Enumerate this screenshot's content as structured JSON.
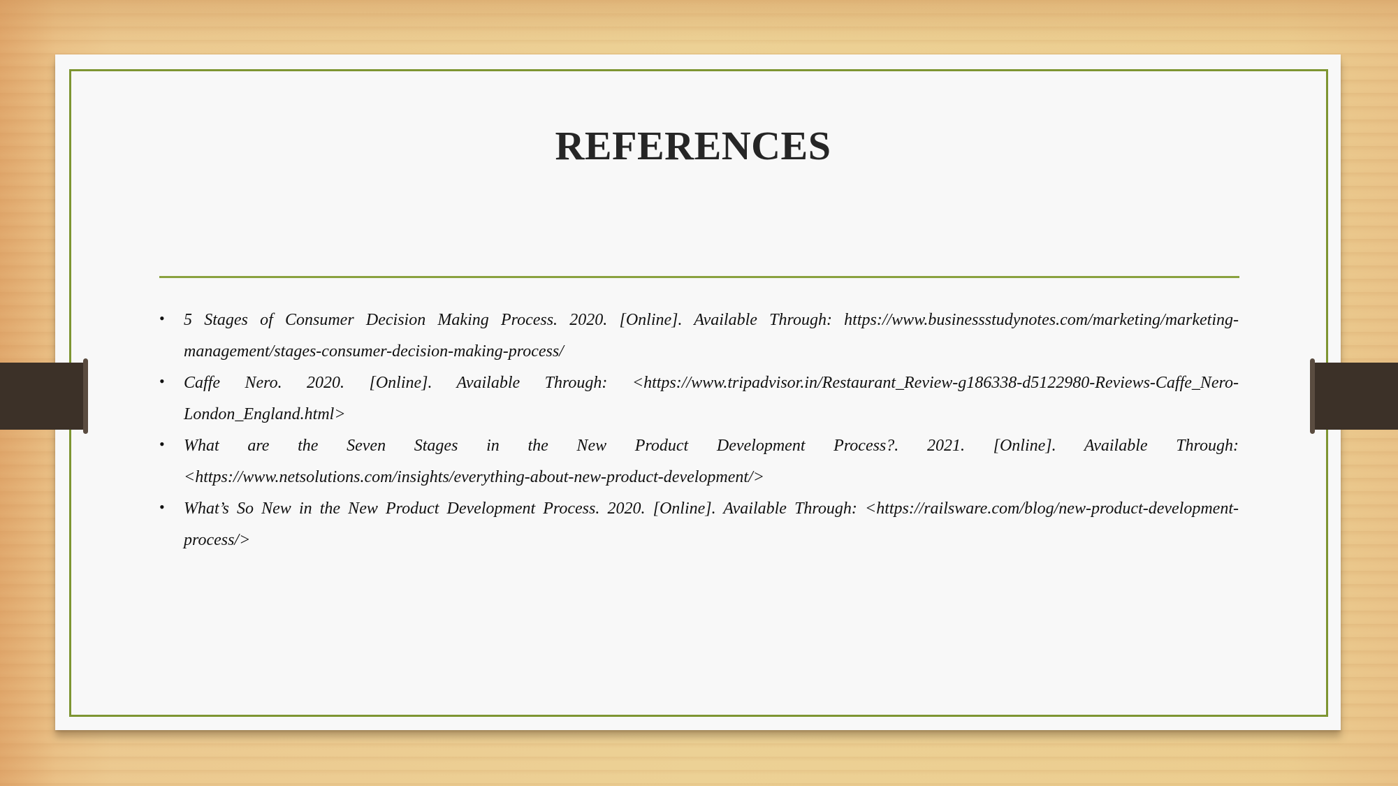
{
  "slide": {
    "title": "REFERENCES",
    "references": [
      {
        "bullet": "•",
        "text": "5 Stages of Consumer Decision Making Process. 2020. [Online]. Available Through: https://www.businessstudynotes.com/marketing/marketing-management/stages-consumer-decision-making-process/"
      },
      {
        "bullet": "•",
        "text": "Caffe Nero. 2020. [Online]. Available Through: <https://www.tripadvisor.in/Restaurant_Review-g186338-d5122980-Reviews-Caffe_Nero-London_England.html>"
      },
      {
        "bullet": "•",
        "text": "What are the Seven Stages in the New Product Development Process?. 2021. [Online]. Available Through: <https://www.netsolutions.com/insights/everything-about-new-product-development/>"
      },
      {
        "bullet": "•",
        "text": "What’s So New in the New Product Development Process. 2020.  [Online]. Available Through: <https://railsware.com/blog/new-product-development-process/>"
      }
    ]
  },
  "colors": {
    "frame_accent": "#7e9532",
    "title_text": "#262626",
    "strap": "#3c3128",
    "card_background": "#f8f8f8"
  }
}
